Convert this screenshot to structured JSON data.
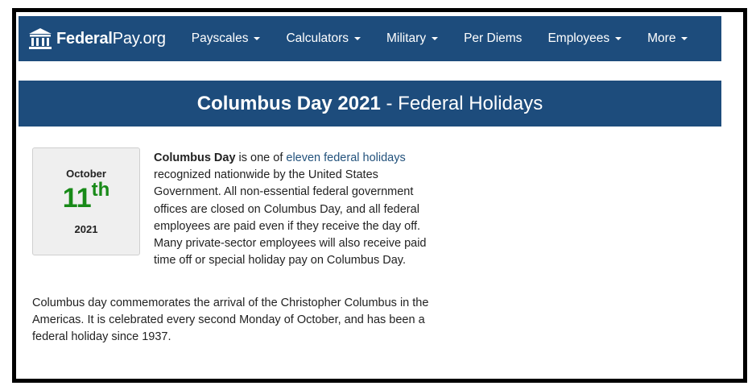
{
  "brand": {
    "name_bold": "Federal",
    "name_rest": "Pay.org"
  },
  "nav": {
    "items": [
      {
        "label": "Payscales",
        "dropdown": true
      },
      {
        "label": "Calculators",
        "dropdown": true
      },
      {
        "label": "Military",
        "dropdown": true
      },
      {
        "label": "Per Diems",
        "dropdown": false
      },
      {
        "label": "Employees",
        "dropdown": true
      },
      {
        "label": "More",
        "dropdown": true
      }
    ]
  },
  "title": {
    "bold": "Columbus Day 2021",
    "rest": " - Federal Holidays"
  },
  "date": {
    "month": "October",
    "day": "11",
    "suffix": "th",
    "year": "2021"
  },
  "content": {
    "p1_bold": "Columbus Day",
    "p1_before_link": " is one of ",
    "p1_link": "eleven federal holidays",
    "p1_after_link": " recognized nationwide by the United States Government. All non-essential federal government offices are closed on Columbus Day, and all federal employees are paid even if they receive the day off. Many private-sector employees will also receive paid time off or special holiday pay on Columbus Day.",
    "p2": "Columbus day commemorates the arrival of the Christopher Columbus in the Americas. It is celebrated every second Monday of October, and has been a federal holiday since 1937."
  },
  "colors": {
    "nav_bg": "#1d4c7c",
    "day_green": "#188a18",
    "link": "#23527c"
  }
}
